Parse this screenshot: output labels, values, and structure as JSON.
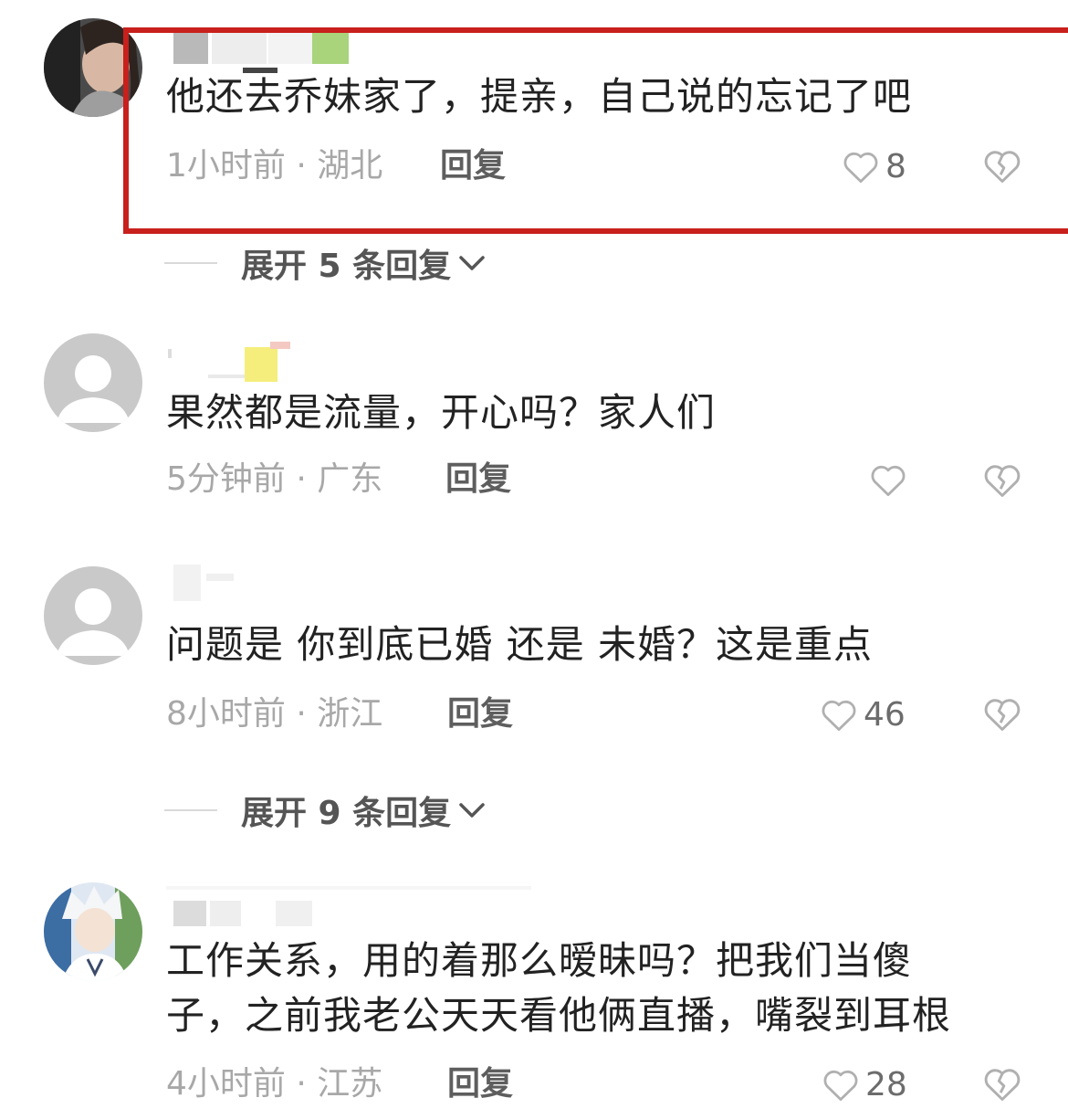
{
  "comments": [
    {
      "text": "他还去乔妹家了，提亲，自己说的忘记了吧",
      "meta": "1小时前 · 湖北",
      "reply": "回复",
      "likes": "8"
    },
    {
      "text": "果然都是流量，开心吗？家人们",
      "meta": "5分钟前 · 广东",
      "reply": "回复",
      "likes": ""
    },
    {
      "text": "问题是 你到底已婚 还是 未婚？这是重点",
      "meta": "8小时前 · 浙江",
      "reply": "回复",
      "likes": "46"
    },
    {
      "text_line1": "工作关系，用的着那么暧昧吗？把我们当傻",
      "text_line2": "子，之前我老公天天看他俩直播，嘴裂到耳根",
      "meta": "4小时前 · 江苏",
      "reply": "回复",
      "likes": "28"
    }
  ],
  "expand": [
    {
      "label": "展开 5 条回复"
    },
    {
      "label": "展开 9 条回复"
    }
  ],
  "colors": {
    "highlight_border": "#c8201c",
    "meta_text": "#a8a8a8",
    "reply_text": "#5e5e5e"
  },
  "icons": [
    "heart-outline-icon",
    "broken-heart-icon",
    "chevron-down-icon",
    "default-avatar-icon"
  ]
}
